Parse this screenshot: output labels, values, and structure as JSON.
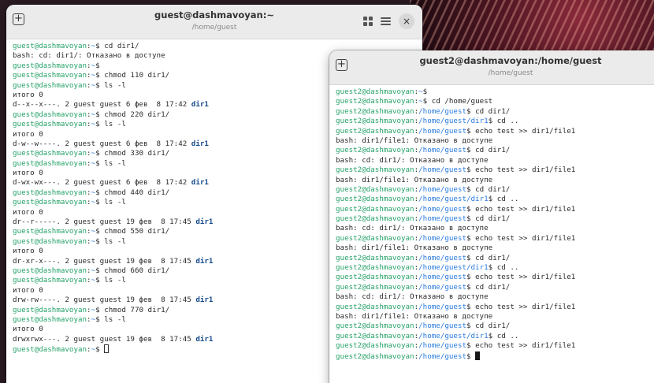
{
  "window1": {
    "title": "guest@dashmavoyan:~",
    "subtitle": "/home/guest",
    "lines": [
      {
        "t": "cmd",
        "u": "guest@dashmavoyan",
        "p": "~",
        "c": "cd dir1/"
      },
      {
        "t": "out",
        "x": "bash: cd: dir1/: Отказано в доступе"
      },
      {
        "t": "cmd",
        "u": "guest@dashmavoyan",
        "p": "~",
        "c": ""
      },
      {
        "t": "cmd",
        "u": "guest@dashmavoyan",
        "p": "~",
        "c": "chmod 110 dir1/"
      },
      {
        "t": "cmd",
        "u": "guest@dashmavoyan",
        "p": "~",
        "c": "ls -l"
      },
      {
        "t": "out",
        "x": "итого 0"
      },
      {
        "t": "ls",
        "x": "d--x--x---. 2 guest guest 6 фев  8 17:42 ",
        "d": "dir1"
      },
      {
        "t": "cmd",
        "u": "guest@dashmavoyan",
        "p": "~",
        "c": "chmod 220 dir1/"
      },
      {
        "t": "cmd",
        "u": "guest@dashmavoyan",
        "p": "~",
        "c": "ls -l"
      },
      {
        "t": "out",
        "x": "итого 0"
      },
      {
        "t": "ls",
        "x": "d-w--w----. 2 guest guest 6 фев  8 17:42 ",
        "d": "dir1"
      },
      {
        "t": "cmd",
        "u": "guest@dashmavoyan",
        "p": "~",
        "c": "chmod 330 dir1/"
      },
      {
        "t": "cmd",
        "u": "guest@dashmavoyan",
        "p": "~",
        "c": "ls -l"
      },
      {
        "t": "out",
        "x": "итого 0"
      },
      {
        "t": "ls",
        "x": "d-wx-wx---. 2 guest guest 6 фев  8 17:42 ",
        "d": "dir1"
      },
      {
        "t": "cmd",
        "u": "guest@dashmavoyan",
        "p": "~",
        "c": "chmod 440 dir1/"
      },
      {
        "t": "cmd",
        "u": "guest@dashmavoyan",
        "p": "~",
        "c": "ls -l"
      },
      {
        "t": "out",
        "x": "итого 0"
      },
      {
        "t": "ls",
        "x": "dr--r-----. 2 guest guest 19 фев  8 17:45 ",
        "d": "dir1"
      },
      {
        "t": "cmd",
        "u": "guest@dashmavoyan",
        "p": "~",
        "c": "chmod 550 dir1/"
      },
      {
        "t": "cmd",
        "u": "guest@dashmavoyan",
        "p": "~",
        "c": "ls -l"
      },
      {
        "t": "out",
        "x": "итого 0"
      },
      {
        "t": "ls",
        "x": "dr-xr-x---. 2 guest guest 19 фев  8 17:45 ",
        "d": "dir1"
      },
      {
        "t": "cmd",
        "u": "guest@dashmavoyan",
        "p": "~",
        "c": "chmod 660 dir1/"
      },
      {
        "t": "cmd",
        "u": "guest@dashmavoyan",
        "p": "~",
        "c": "ls -l"
      },
      {
        "t": "out",
        "x": "итого 0"
      },
      {
        "t": "ls",
        "x": "drw-rw----. 2 guest guest 19 фев  8 17:45 ",
        "d": "dir1"
      },
      {
        "t": "cmd",
        "u": "guest@dashmavoyan",
        "p": "~",
        "c": "chmod 770 dir1/"
      },
      {
        "t": "cmd",
        "u": "guest@dashmavoyan",
        "p": "~",
        "c": "ls -l"
      },
      {
        "t": "out",
        "x": "итого 0"
      },
      {
        "t": "ls",
        "x": "drwxrwx---. 2 guest guest 19 фев  8 17:45 ",
        "d": "dir1"
      },
      {
        "t": "cmd",
        "u": "guest@dashmavoyan",
        "p": "~",
        "c": "",
        "cursor": "hollow"
      }
    ]
  },
  "window2": {
    "title": "guest2@dashmavoyan:/home/guest",
    "subtitle": "/home/guest",
    "lines": [
      {
        "t": "cmd",
        "u": "guest2@dashmavoyan",
        "p": "~",
        "c": ""
      },
      {
        "t": "cmd",
        "u": "guest2@dashmavoyan",
        "p": "~",
        "c": "cd /home/guest"
      },
      {
        "t": "cmd",
        "u": "guest2@dashmavoyan",
        "p": "/home/guest",
        "c": "cd dir1/"
      },
      {
        "t": "cmd",
        "u": "guest2@dashmavoyan",
        "p": "/home/guest/dir1",
        "c": "cd .."
      },
      {
        "t": "cmd",
        "u": "guest2@dashmavoyan",
        "p": "/home/guest",
        "c": "echo test >> dir1/file1"
      },
      {
        "t": "out",
        "x": "bash: dir1/file1: Отказано в доступе"
      },
      {
        "t": "cmd",
        "u": "guest2@dashmavoyan",
        "p": "/home/guest",
        "c": "cd dir1/"
      },
      {
        "t": "out",
        "x": "bash: cd: dir1/: Отказано в доступе"
      },
      {
        "t": "cmd",
        "u": "guest2@dashmavoyan",
        "p": "/home/guest",
        "c": "echo test >> dir1/file1"
      },
      {
        "t": "out",
        "x": "bash: dir1/file1: Отказано в доступе"
      },
      {
        "t": "cmd",
        "u": "guest2@dashmavoyan",
        "p": "/home/guest",
        "c": "cd dir1/"
      },
      {
        "t": "cmd",
        "u": "guest2@dashmavoyan",
        "p": "/home/guest/dir1",
        "c": "cd .."
      },
      {
        "t": "cmd",
        "u": "guest2@dashmavoyan",
        "p": "/home/guest",
        "c": "echo test >> dir1/file1"
      },
      {
        "t": "cmd",
        "u": "guest2@dashmavoyan",
        "p": "/home/guest",
        "c": "cd dir1/"
      },
      {
        "t": "out",
        "x": "bash: cd: dir1/: Отказано в доступе"
      },
      {
        "t": "cmd",
        "u": "guest2@dashmavoyan",
        "p": "/home/guest",
        "c": "echo test >> dir1/file1"
      },
      {
        "t": "out",
        "x": "bash: dir1/file1: Отказано в доступе"
      },
      {
        "t": "cmd",
        "u": "guest2@dashmavoyan",
        "p": "/home/guest",
        "c": "cd dir1/"
      },
      {
        "t": "cmd",
        "u": "guest2@dashmavoyan",
        "p": "/home/guest/dir1",
        "c": "cd .."
      },
      {
        "t": "cmd",
        "u": "guest2@dashmavoyan",
        "p": "/home/guest",
        "c": "echo test >> dir1/file1"
      },
      {
        "t": "cmd",
        "u": "guest2@dashmavoyan",
        "p": "/home/guest",
        "c": "cd dir1/"
      },
      {
        "t": "out",
        "x": "bash: cd: dir1/: Отказано в доступе"
      },
      {
        "t": "cmd",
        "u": "guest2@dashmavoyan",
        "p": "/home/guest",
        "c": "echo test >> dir1/file1"
      },
      {
        "t": "out",
        "x": "bash: dir1/file1: Отказано в доступе"
      },
      {
        "t": "cmd",
        "u": "guest2@dashmavoyan",
        "p": "/home/guest",
        "c": "cd dir1/"
      },
      {
        "t": "cmd",
        "u": "guest2@dashmavoyan",
        "p": "/home/guest/dir1",
        "c": "cd .."
      },
      {
        "t": "cmd",
        "u": "guest2@dashmavoyan",
        "p": "/home/guest",
        "c": "echo test >> dir1/file1"
      },
      {
        "t": "cmd",
        "u": "guest2@dashmavoyan",
        "p": "/home/guest",
        "c": "",
        "cursor": "block"
      }
    ]
  },
  "icons": {
    "new_tab": "+",
    "close": "×"
  },
  "colors": {
    "prompt_user": "#26a269",
    "prompt_path": "#2a7bde",
    "directory": "#12488b",
    "text": "#2b2b2b",
    "titlebar": "#ebebeb"
  }
}
